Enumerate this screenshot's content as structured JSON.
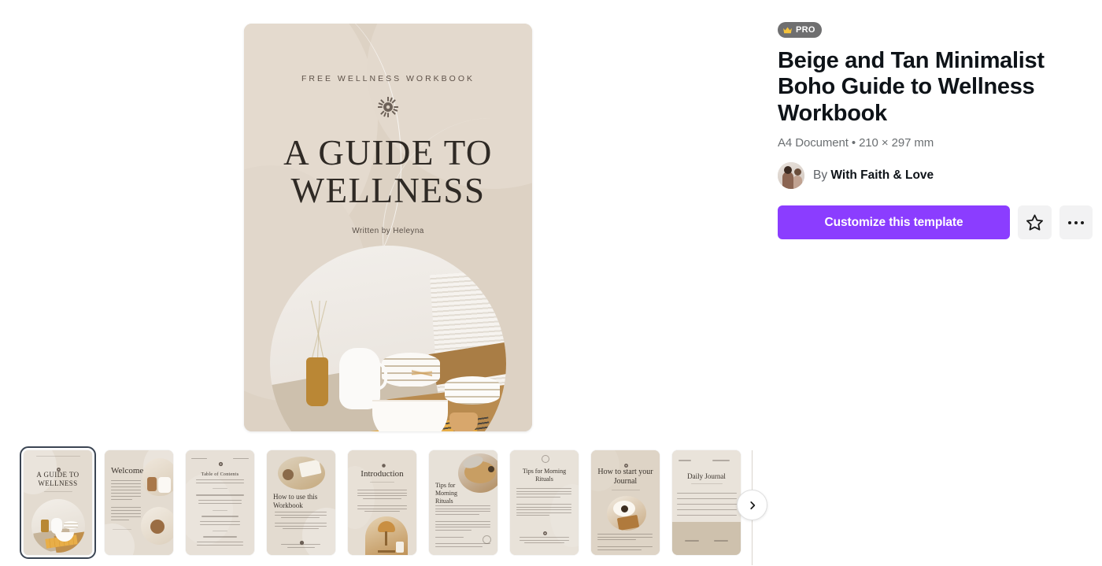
{
  "badge": {
    "label": "PRO",
    "icon": "crown-icon",
    "bg_color": "#6f6f70",
    "crown_color": "#f5c33b"
  },
  "template": {
    "title": "Beige and Tan Minimalist Boho Guide to Wellness Workbook",
    "meta": "A4 Document • 210 × 297 mm",
    "doc_type": "A4 Document",
    "dimensions": "210 × 297 mm"
  },
  "author": {
    "by_label": "By",
    "name": "With Faith & Love",
    "avatar": "author-avatar-photo"
  },
  "actions": {
    "primary_label": "Customize this template",
    "primary_color": "#8b3dff",
    "favorite_icon": "star-icon",
    "more_icon": "more-options-icon"
  },
  "cover": {
    "kicker": "FREE WELLNESS WORKBOOK",
    "ornament": "sun-ornament-icon",
    "title_line1": "A GUIDE TO",
    "title_line2": "WELLNESS",
    "author_credit": "Written by Heleyna",
    "background_color": "#ddd2c4",
    "photo": "table-setting-photo"
  },
  "thumbnails": {
    "next_icon": "chevron-right-icon",
    "selected_index": 0,
    "items": [
      {
        "label": "A GUIDE TO WELLNESS",
        "page": "cover"
      },
      {
        "label": "Welcome",
        "page": "welcome"
      },
      {
        "label": "Table of Contents",
        "page": "contents"
      },
      {
        "label": "How to use this Workbook",
        "page": "how-to-use"
      },
      {
        "label": "Introduction",
        "page": "introduction"
      },
      {
        "label": "Tips for Morning Rituals",
        "page": "tips-morning-rituals-1"
      },
      {
        "label": "Tips for Morning Rituals",
        "page": "tips-morning-rituals-2"
      },
      {
        "label": "How to start your Journal",
        "page": "start-journal"
      },
      {
        "label": "Daily Journal",
        "page": "daily-journal"
      }
    ]
  }
}
